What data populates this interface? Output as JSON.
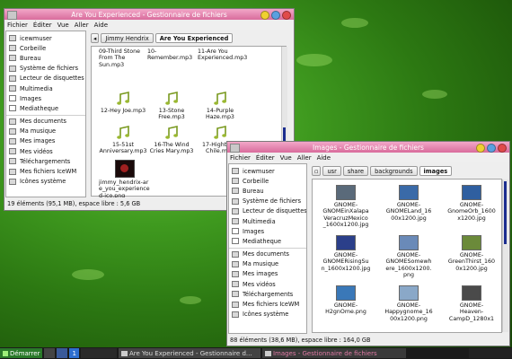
{
  "colors": {
    "titlebar": "#e07aa5",
    "accent": "#1b2d8f",
    "desktop": "#3f9a1f"
  },
  "window1": {
    "title": "Are You Experienced - Gestionnaire de fichiers",
    "menu": [
      "Fichier",
      "Éditer",
      "Vue",
      "Aller",
      "Aide"
    ],
    "sidebar": [
      "icewmuser",
      "Corbeille",
      "Bureau",
      "Système de fichiers",
      "Lecteur de disquettes",
      "Multimedia",
      "Images",
      "Mediatheque",
      "Mes documents",
      "Ma musique",
      "Mes images",
      "Mes vidéos",
      "Téléchargements",
      "Mes fichiers IceWM",
      "Icônes système"
    ],
    "path": [
      "Jimmy Hendrix",
      "Are You Experienced"
    ],
    "files_top": [
      "09-Third Stone From The Sun.mp3",
      "10-Remember.mp3",
      "11-Are You Experienced.mp3"
    ],
    "files": [
      "12-Hey Joe.mp3",
      "13-Stone Free.mp3",
      "14-Purple Haze.mp3",
      "15-51st Anniversary.mp3",
      "16-The Wind Cries Mary.mp3",
      "17-Hightway Chile.mp3",
      "jimmy_hendrix-are_you_experienced-ico.png"
    ],
    "status": "19 éléments (95,1 MB), espace libre : 5,6 GB"
  },
  "window2": {
    "title": "Images - Gestionnaire de fichiers",
    "menu": [
      "Fichier",
      "Éditer",
      "Vue",
      "Aller",
      "Aide"
    ],
    "sidebar": [
      "icewmuser",
      "Corbeille",
      "Bureau",
      "Système de fichiers",
      "Lecteur de disquettes",
      "Multimedia",
      "Images",
      "Mediatheque",
      "Mes documents",
      "Ma musique",
      "Mes images",
      "Mes vidéos",
      "Téléchargements",
      "Mes fichiers IceWM",
      "Icônes système"
    ],
    "path": [
      "usr",
      "share",
      "backgrounds",
      "images"
    ],
    "files": [
      {
        "name": "GNOME-GNOMEinXalapaVeracruzMexico_1600x1200.jpg",
        "lines": [
          "GNOME-",
          "GNOMEinXalapa",
          "VeracruzMexico",
          "_1600x1200.jpg"
        ],
        "tint": "#5a6a7a"
      },
      {
        "name": "GNOME-GNOMELand_1600x1200.jpg",
        "lines": [
          "GNOME-",
          "GNOMELand_16",
          "00x1200.jpg"
        ],
        "tint": "#3a6aa8"
      },
      {
        "name": "GNOME-GnomeOrb_1600x1200.jpg",
        "lines": [
          "GNOME-",
          "GnomeOrb_1600",
          "x1200.jpg"
        ],
        "tint": "#2f5fa0"
      },
      {
        "name": "GNOME-GNOMERisingSun_1600x1200.jpg",
        "lines": [
          "GNOME-",
          "GNOMERisingSu",
          "n_1600x1200.jpg"
        ],
        "tint": "#2b3f8a"
      },
      {
        "name": "GNOME-GNOMESomewhere_1600x1200.png",
        "lines": [
          "GNOME-",
          "GNOMESomewh",
          "ere_1600x1200.",
          "png"
        ],
        "tint": "#6a8ab8"
      },
      {
        "name": "GNOME-GreenThirst_1600x1200.jpg",
        "lines": [
          "GNOME-",
          "GreenThirst_160",
          "0x1200.jpg"
        ],
        "tint": "#6b8a3a"
      },
      {
        "name": "GNOME-H2gnOme.png",
        "lines": [
          "GNOME-",
          "H2gnOme.png"
        ],
        "tint": "#3a78b8"
      },
      {
        "name": "GNOME-Happygnome_1600x1200.png",
        "lines": [
          "GNOME-",
          "Happygnome_16",
          "00x1200.png"
        ],
        "tint": "#8aa8c8"
      },
      {
        "name": "GNOME-Heaven-CampD_1280x1",
        "lines": [
          "GNOME-",
          "Heaven-",
          "CampD_1280x1"
        ],
        "tint": "#4a4a4a"
      }
    ],
    "status": "88 éléments (38,6 MB), espace libre : 164,0 GB"
  },
  "taskbar": {
    "start": "Démarrer",
    "workspace": "1",
    "task1": "Are You Experienced - Gestionnaire d...",
    "task2": "Images - Gestionnaire de fichiers"
  }
}
